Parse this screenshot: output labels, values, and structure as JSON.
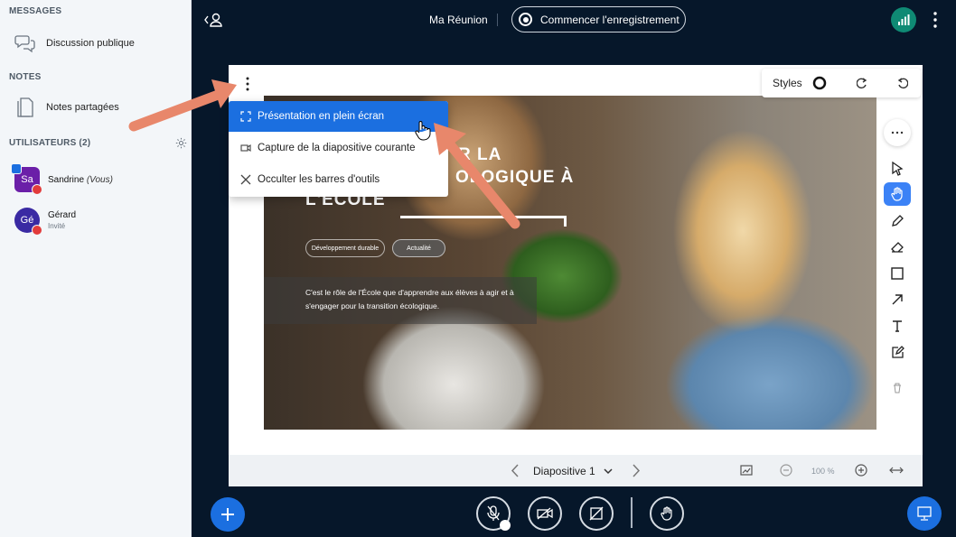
{
  "sidebar": {
    "messages_title": "MESSAGES",
    "public_chat_label": "Discussion publique",
    "notes_title": "NOTES",
    "shared_notes_label": "Notes partagées",
    "users_title": "UTILISATEURS (2)",
    "users": [
      {
        "initials": "Sa",
        "name": "Sandrine",
        "suffix": "(Vous)",
        "role": "",
        "color": "#6b1fa8"
      },
      {
        "initials": "Gé",
        "name": "Gérard",
        "suffix": "",
        "role": "Invité",
        "color": "#3a2aa3"
      }
    ]
  },
  "topbar": {
    "meeting_title": "Ma Réunion",
    "record_label": "Commencer l'enregistrement"
  },
  "presentation": {
    "styles_label": "Styles",
    "slide_title_line1": "R LA",
    "slide_title_line2": "OLOGIQUE À",
    "slide_title_line3": "L'ÉCOLE",
    "tag1": "Développement durable",
    "tag2": "Actualité",
    "slide_desc_line1": "C'est le rôle de l'École que d'apprendre aux élèves à agir et à",
    "slide_desc_line2": "s'engager pour la transition écologique.",
    "slide_label": "Diapositive 1",
    "zoom": "100 %"
  },
  "menu": {
    "items": [
      {
        "label": "Présentation en plein écran",
        "icon": "fullscreen-icon"
      },
      {
        "label": "Capture de la diapositive courante",
        "icon": "camera-icon"
      },
      {
        "label": "Occulter les barres d'outils",
        "icon": "close-icon"
      }
    ]
  },
  "colors": {
    "accent": "#1b6fe0",
    "background": "#06172a",
    "annotation_arrow": "#e8876b"
  }
}
